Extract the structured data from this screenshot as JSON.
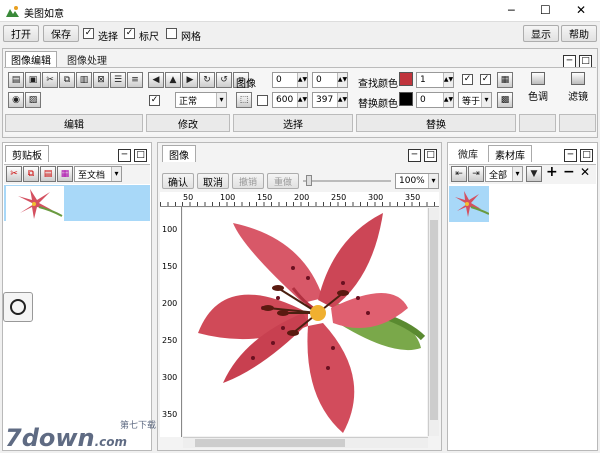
{
  "window": {
    "title": "美图如意",
    "min": "─",
    "max": "☐",
    "close": "✕"
  },
  "toolbar": {
    "open": "打开",
    "save": "保存",
    "select_label": "选择",
    "ruler_label": "标尺",
    "grid_label": "网格",
    "show": "显示",
    "help": "帮助"
  },
  "ribbon": {
    "tabs": [
      "图像编辑",
      "图像处理"
    ],
    "groups": {
      "edit": "编辑",
      "modify": "修改",
      "select": "选择",
      "replace": "替换"
    },
    "image_label": "图像",
    "x_val": "0",
    "y_val": "0",
    "w_val": "600",
    "h_val": "397",
    "mode_value": "正常",
    "find_color_label": "查找颜色",
    "replace_color_label": "替换颜色",
    "find_val": "1",
    "replace_val": "0",
    "equal_value": "等于",
    "find_color": "#c0343c",
    "replace_color": "#000000",
    "tone_label": "色调",
    "filter_label": "滤镜"
  },
  "clipboard": {
    "tab": "剪贴板",
    "to_doc": "至文档"
  },
  "image_panel": {
    "tab": "图像",
    "confirm": "确认",
    "cancel": "取消",
    "undo": "撤销",
    "redo": "重做",
    "zoom": "100%",
    "ruler_h": [
      "50",
      "100",
      "150",
      "200",
      "250",
      "300",
      "350"
    ],
    "ruler_v": [
      "100",
      "150",
      "200",
      "250",
      "300",
      "350"
    ]
  },
  "library": {
    "tabs": [
      "微库",
      "素材库"
    ],
    "filter": "全部"
  },
  "watermark": {
    "main": "7down",
    "sub": ".com",
    "cn": "第七下载"
  }
}
